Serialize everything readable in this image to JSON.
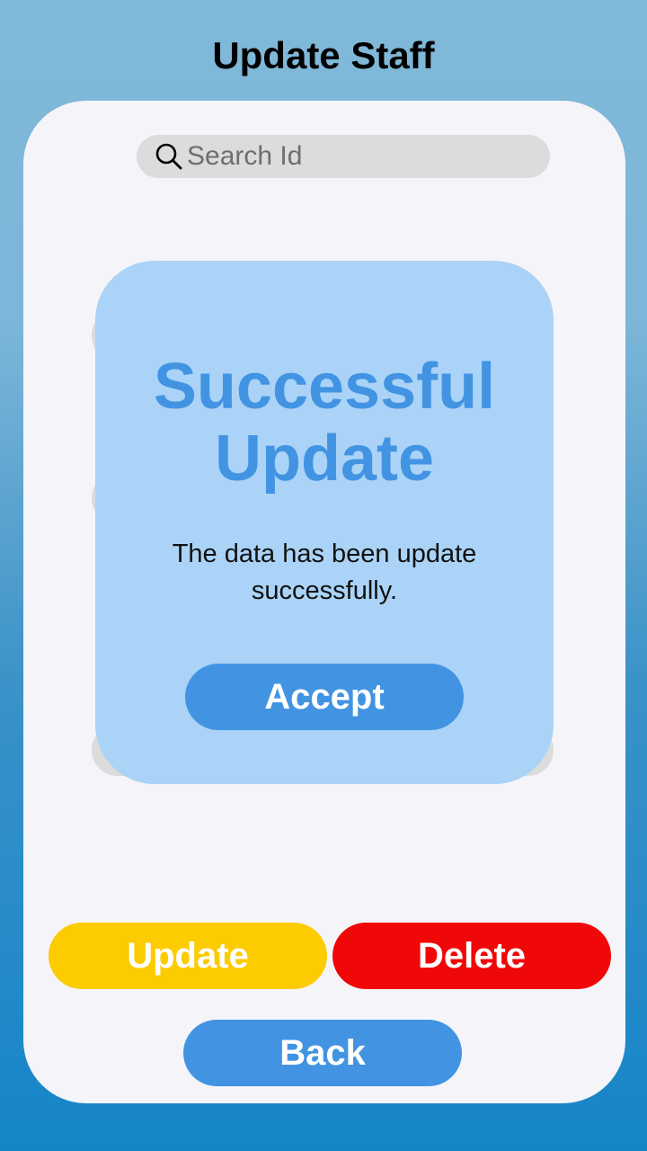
{
  "header": {
    "title": "Update Staff"
  },
  "search": {
    "placeholder": "Search Id",
    "icon": "search-icon"
  },
  "dialog": {
    "title": "Successful\nUpdate",
    "message": "The data has been update successfully.",
    "accept_label": "Accept",
    "color": "#aad3f7",
    "title_color": "#4294e3"
  },
  "actions": {
    "update_label": "Update",
    "delete_label": "Delete",
    "back_label": "Back"
  },
  "colors": {
    "update": "#fccb00",
    "delete": "#f00808",
    "primary": "#4294e3"
  }
}
